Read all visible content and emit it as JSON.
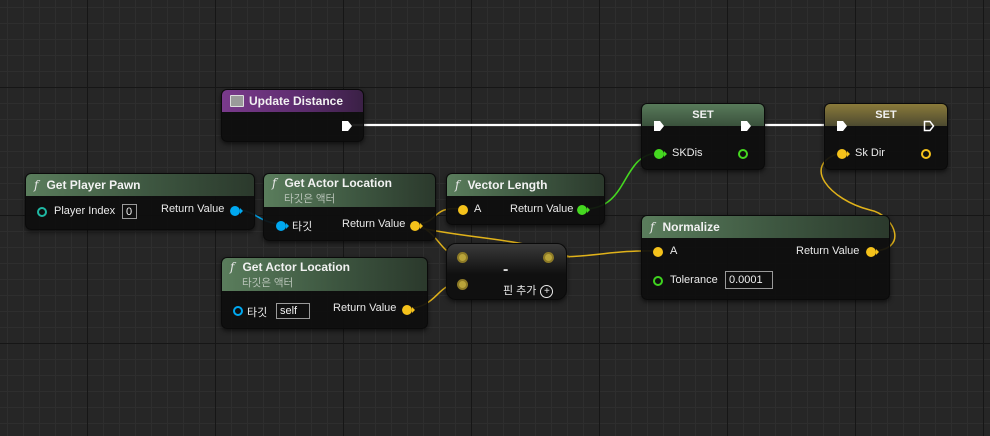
{
  "nodes": {
    "update_distance": {
      "title": "Update Distance"
    },
    "get_player_pawn": {
      "title": "Get Player Pawn",
      "player_index_label": "Player Index",
      "player_index_value": "0",
      "return_label": "Return Value"
    },
    "get_actor_location_1": {
      "title": "Get Actor Location",
      "subtitle": "타깃은 액터",
      "target_label": "타깃",
      "return_label": "Return Value"
    },
    "get_actor_location_2": {
      "title": "Get Actor Location",
      "subtitle": "타깃은 액터",
      "target_label": "타깃",
      "target_value": "self",
      "return_label": "Return Value"
    },
    "vector_length": {
      "title": "Vector Length",
      "a_label": "A",
      "return_label": "Return Value"
    },
    "subtract": {
      "symbol": "-",
      "add_pin_label": "핀 추가",
      "add_pin_symbol": "+"
    },
    "normalize": {
      "title": "Normalize",
      "a_label": "A",
      "tolerance_label": "Tolerance",
      "tolerance_value": "0.0001",
      "return_label": "Return Value"
    },
    "set_skdis": {
      "title": "SET",
      "var_label": "SKDis"
    },
    "set_skdir": {
      "title": "SET",
      "var_label": "Sk Dir"
    }
  },
  "colors": {
    "exec": "#ffffff",
    "object_pin": "#00a8f0",
    "vector_pin": "#f5c21b",
    "float_pin": "#45d820",
    "function_header": "#5a7d5c",
    "event_header": "#7a3a8c",
    "set_gold_header": "#8a7a3a"
  },
  "icons": {
    "function": "function-f-icon",
    "event": "event-icon",
    "exec": "exec-arrow-icon",
    "add": "plus-circle-icon"
  }
}
